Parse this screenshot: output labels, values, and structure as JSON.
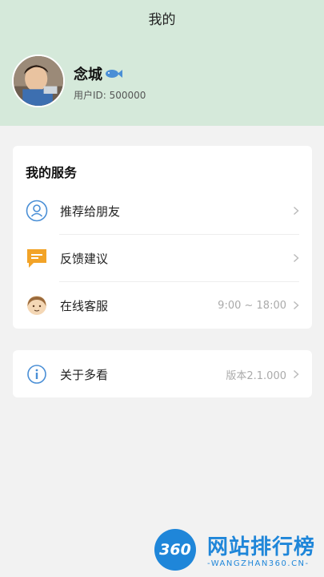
{
  "header": {
    "title": "我的",
    "username": "念城",
    "user_id_label": "用户ID: 500000"
  },
  "services": {
    "title": "我的服务",
    "items": [
      {
        "label": "推荐给朋友",
        "icon": "user-share-icon",
        "value": ""
      },
      {
        "label": "反馈建议",
        "icon": "feedback-icon",
        "value": ""
      },
      {
        "label": "在线客服",
        "icon": "customer-service-icon",
        "value": "9:00 ~ 18:00"
      }
    ]
  },
  "about": {
    "label": "关于多看",
    "icon": "info-icon",
    "version": "版本2.1.000"
  },
  "watermark": {
    "badge": "360",
    "title": "网站排行榜",
    "subtitle": "-WANGZHAN360.CN-"
  },
  "colors": {
    "header_bg": "#d5e9da",
    "accent_blue": "#4a8fd6",
    "feedback_orange": "#f2a327"
  }
}
